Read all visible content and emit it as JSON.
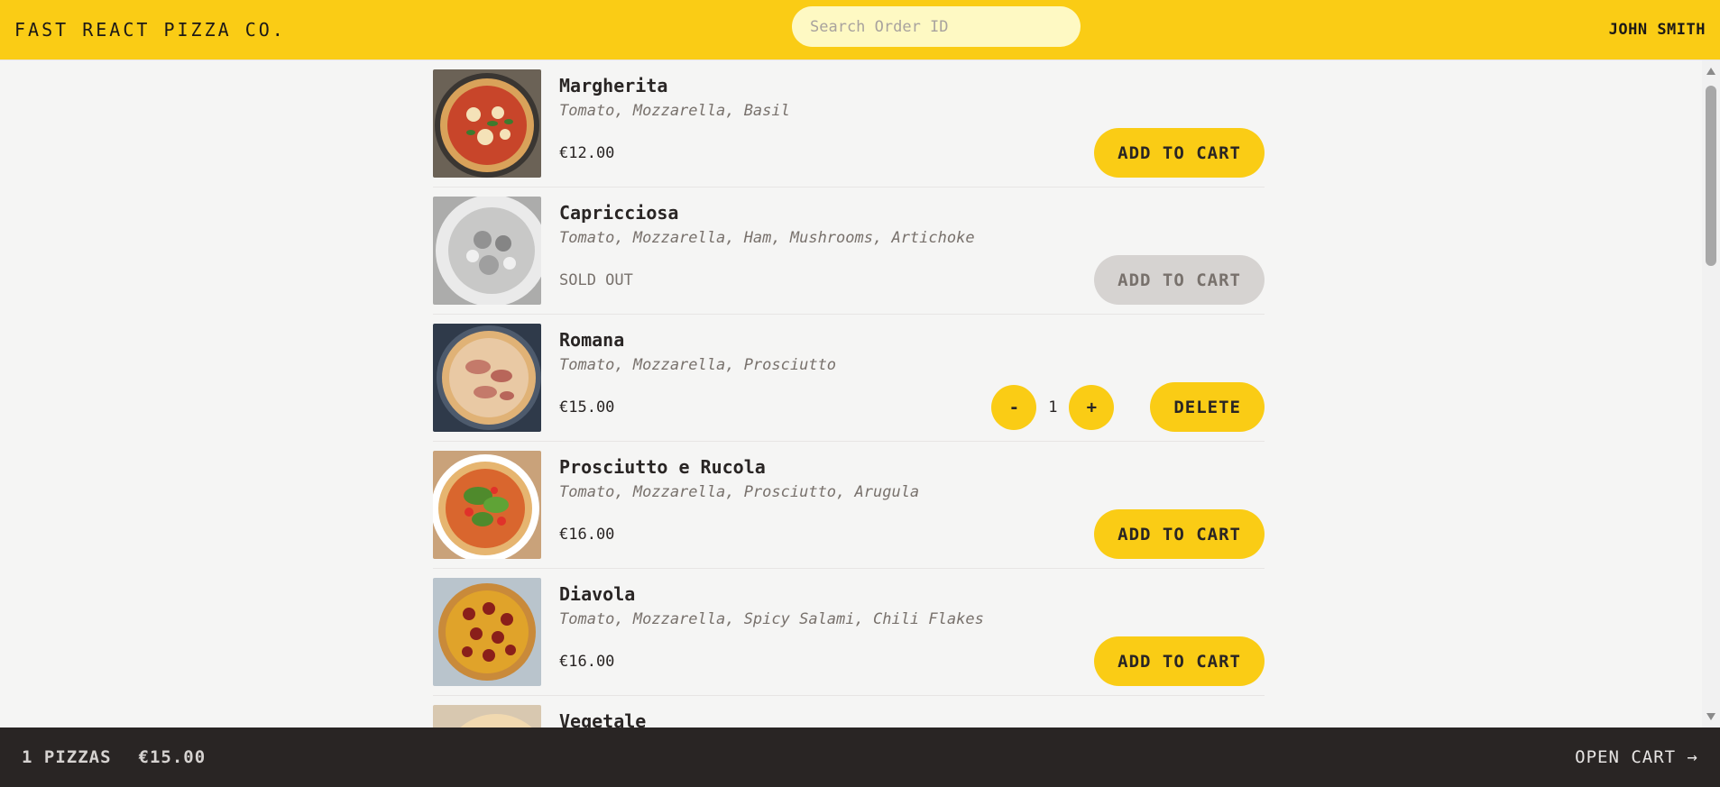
{
  "header": {
    "logo": "FAST REACT PIZZA CO.",
    "search_placeholder": "Search Order ID",
    "user": "JOHN SMITH"
  },
  "menu": [
    {
      "name": "Margherita",
      "ingredients": "Tomato, Mozzarella, Basil",
      "price": "€12.00",
      "sold_out": false,
      "button": "ADD TO CART"
    },
    {
      "name": "Capricciosa",
      "ingredients": "Tomato, Mozzarella, Ham, Mushrooms, Artichoke",
      "price": "SOLD OUT",
      "sold_out": true,
      "button": "ADD TO CART"
    },
    {
      "name": "Romana",
      "ingredients": "Tomato, Mozzarella, Prosciutto",
      "price": "€15.00",
      "sold_out": false,
      "in_cart": true,
      "quantity": "1",
      "decrease": "-",
      "increase": "+",
      "delete": "DELETE"
    },
    {
      "name": "Prosciutto e Rucola",
      "ingredients": "Tomato, Mozzarella, Prosciutto, Arugula",
      "price": "€16.00",
      "sold_out": false,
      "button": "ADD TO CART"
    },
    {
      "name": "Diavola",
      "ingredients": "Tomato, Mozzarella, Spicy Salami, Chili Flakes",
      "price": "€16.00",
      "sold_out": false,
      "button": "ADD TO CART"
    },
    {
      "name": "Vegetale",
      "ingredients": "",
      "price": "",
      "sold_out": false,
      "button": ""
    }
  ],
  "footer": {
    "pizza_count": "1 PIZZAS",
    "total": "€15.00",
    "open_cart": "OPEN CART →"
  },
  "colors": {
    "accent": "#facc15",
    "footer_bg": "#292524",
    "page_bg": "#f5f5f4"
  }
}
